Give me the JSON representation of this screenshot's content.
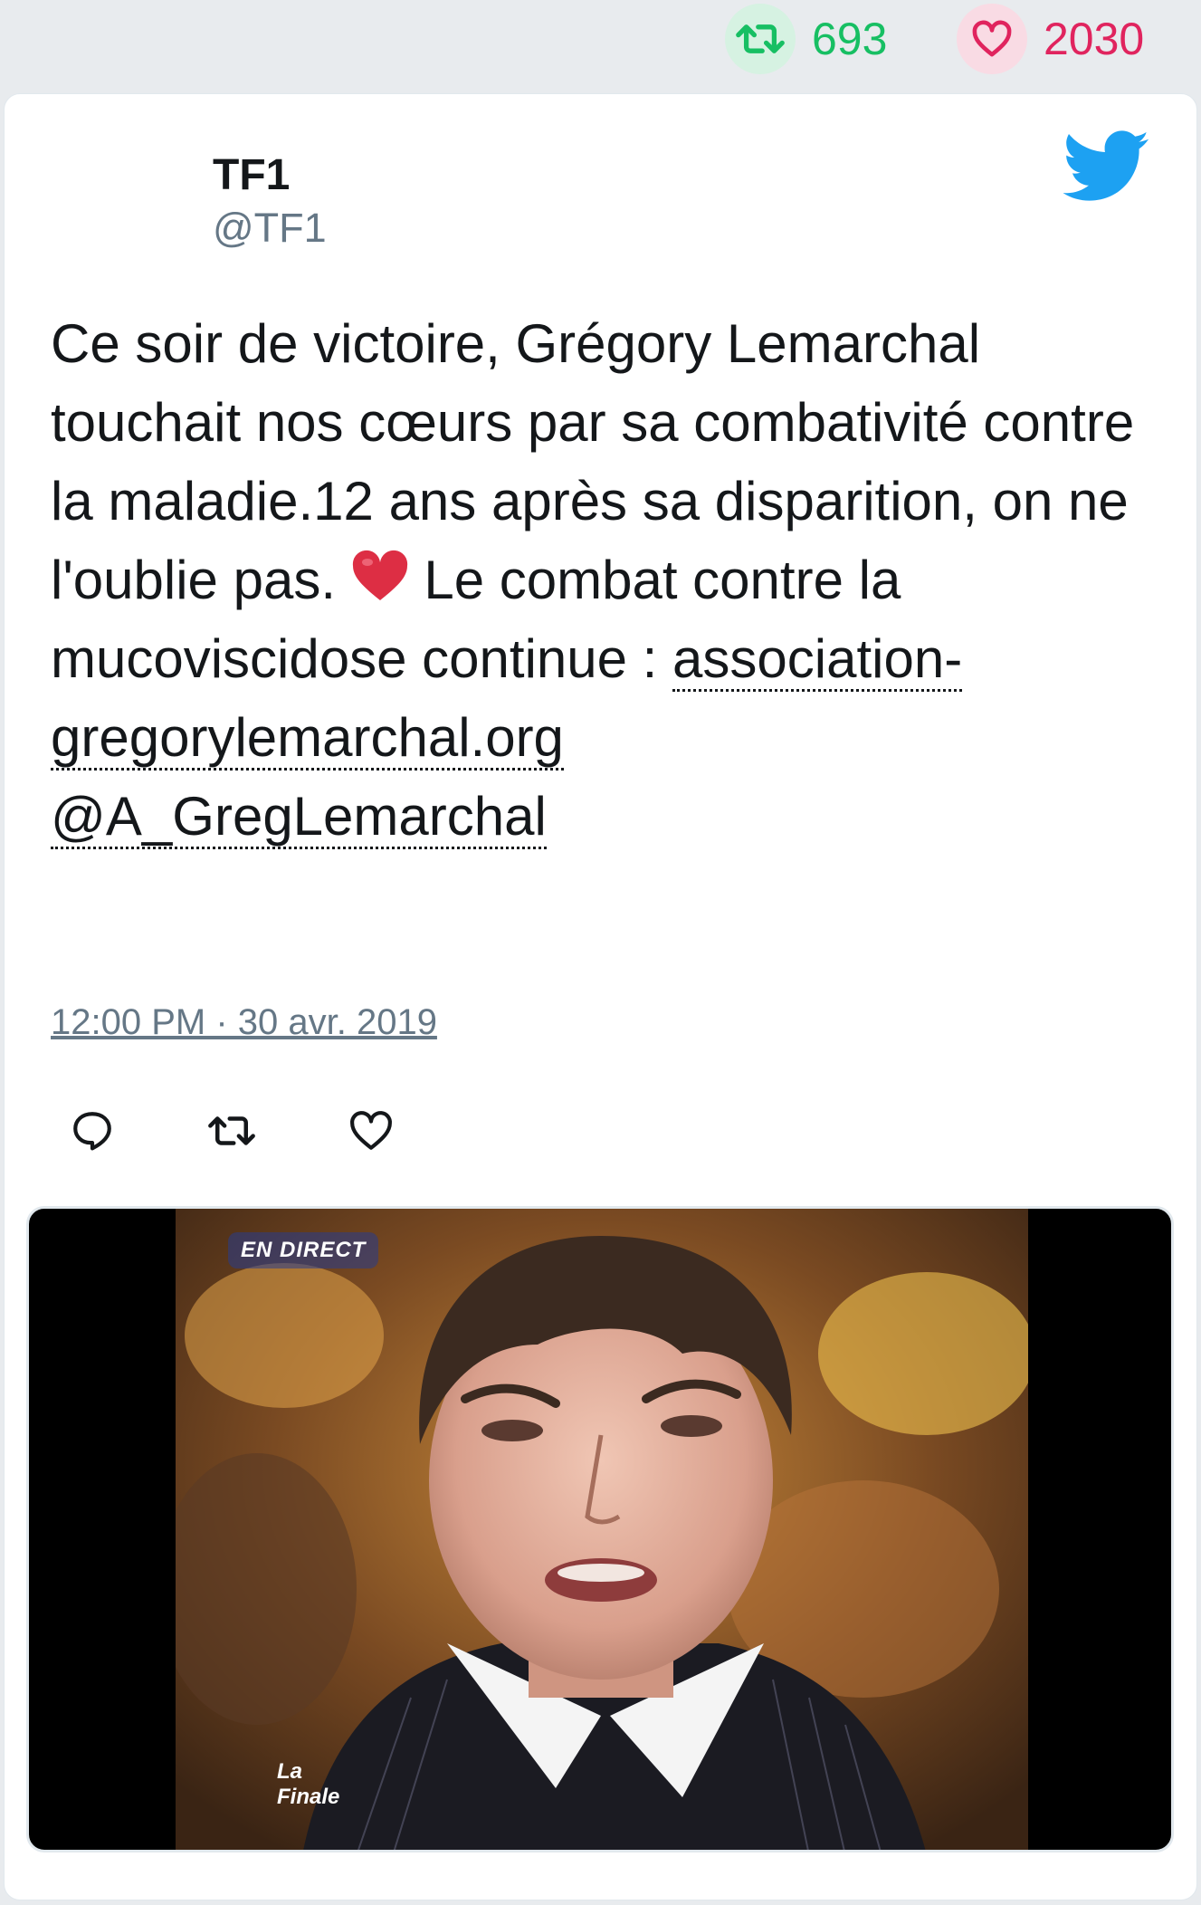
{
  "stats": {
    "retweets": "693",
    "likes": "2030",
    "retweet_color": "#17bf63",
    "like_color": "#e0245e"
  },
  "author": {
    "name": "TF1",
    "handle": "@TF1"
  },
  "tweet": {
    "text_part1": "Ce soir de victoire, Grégory Lemarchal touchait nos cœurs par sa combativité contre la maladie.12 ans après sa disparition, on ne l'oublie pas.",
    "text_part2": "Le combat contre la mucoviscidose continue :",
    "link_url_text": "association-gregorylemarchal.org",
    "mention": "@A_GregLemarchal",
    "timestamp": "12:00 PM · 30 avr. 2019"
  },
  "actions": {
    "reply_icon": "reply-icon",
    "retweet_icon": "retweet-icon",
    "like_icon": "heart-icon"
  },
  "media": {
    "live_badge": "EN DIRECT",
    "caption_line1": "La",
    "caption_line2": "Finale"
  },
  "colors": {
    "twitter_blue": "#1da1f2",
    "text_primary": "#14171a",
    "text_secondary": "#657786",
    "background": "#e8ebee"
  }
}
